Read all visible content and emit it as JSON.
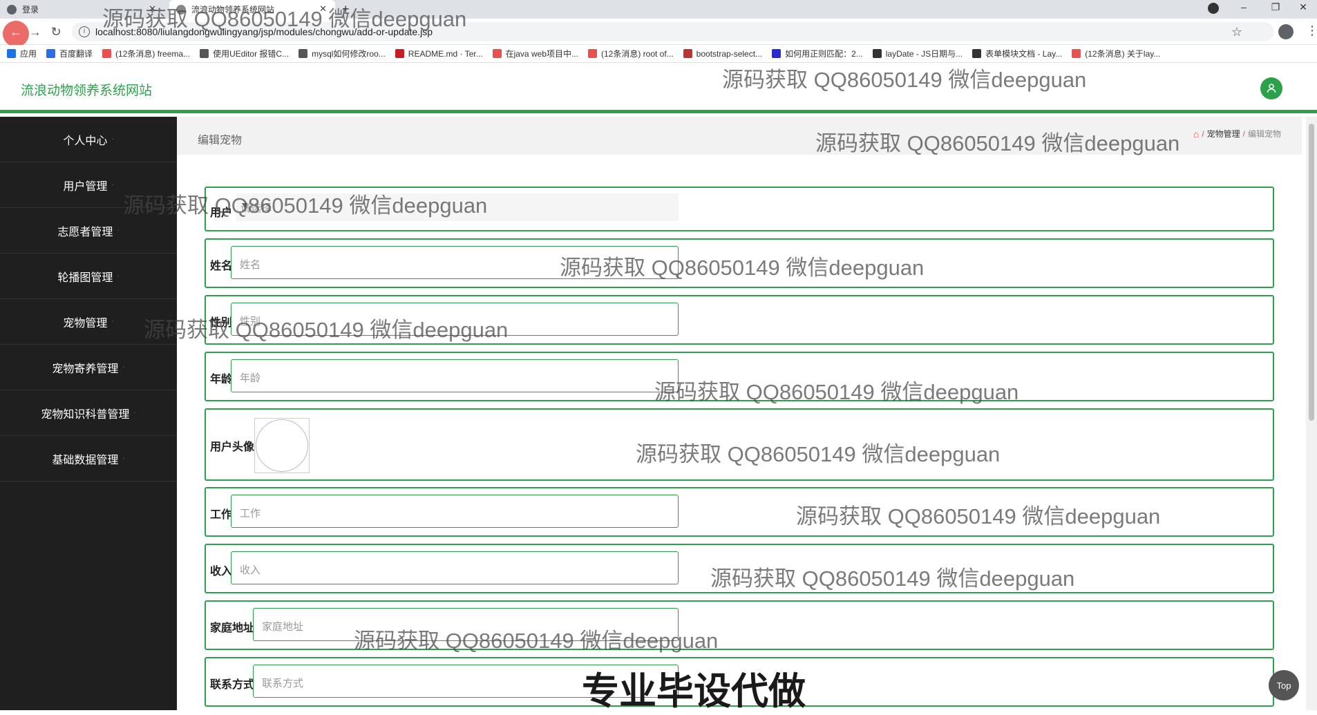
{
  "browser": {
    "tabs": [
      {
        "title": "登录"
      },
      {
        "title": "流浪动物领养系统网站"
      }
    ],
    "new_tab": "+",
    "url": "localhost:8080/liulangdongwulingyang/jsp/modules/chongwu/add-or-update.jsp",
    "bookmarks": [
      {
        "label": "应用",
        "color": "#1a73e8"
      },
      {
        "label": "百度翻译",
        "color": "#2b6de5"
      },
      {
        "label": "(12条消息) freema...",
        "color": "#e8514d"
      },
      {
        "label": "使用UEditor 报错C...",
        "color": "#555555"
      },
      {
        "label": "mysql如何修改roo...",
        "color": "#555555"
      },
      {
        "label": "README.md · Ter...",
        "color": "#c71d23"
      },
      {
        "label": "在java web项目中...",
        "color": "#e8514d"
      },
      {
        "label": "(12条消息) root of...",
        "color": "#e8514d"
      },
      {
        "label": "bootstrap-select...",
        "color": "#b33"
      },
      {
        "label": "如何用正则匹配：2...",
        "color": "#2b2bd6"
      },
      {
        "label": "layDate - JS日期与...",
        "color": "#333333"
      },
      {
        "label": "表单模块文档 - Lay...",
        "color": "#333333"
      },
      {
        "label": "(12条消息) 关于lay...",
        "color": "#e8514d"
      }
    ]
  },
  "header": {
    "site_title": "流浪动物领养系统网站"
  },
  "sidebar": {
    "items": [
      {
        "label": "个人中心"
      },
      {
        "label": "用户管理"
      },
      {
        "label": "志愿者管理"
      },
      {
        "label": "轮播图管理"
      },
      {
        "label": "宠物管理"
      },
      {
        "label": "宠物寄养管理"
      },
      {
        "label": "宠物知识科普管理"
      },
      {
        "label": "基础数据管理"
      }
    ]
  },
  "page": {
    "title": "编辑宠物",
    "breadcrumb": [
      "宠物管理",
      "编辑宠物"
    ]
  },
  "form": {
    "user": {
      "label": "用户",
      "placeholder": "请选择"
    },
    "name": {
      "label": "姓名",
      "placeholder": "姓名"
    },
    "gender": {
      "label": "性别",
      "placeholder": "性别"
    },
    "age": {
      "label": "年龄",
      "placeholder": "年龄"
    },
    "avatar": {
      "label": "用户头像"
    },
    "job": {
      "label": "工作",
      "placeholder": "工作"
    },
    "income": {
      "label": "收入",
      "placeholder": "收入"
    },
    "address": {
      "label": "家庭地址",
      "placeholder": "家庭地址"
    },
    "contact": {
      "label": "联系方式",
      "placeholder": "联系方式"
    }
  },
  "top_button": "Top",
  "watermark": "源码获取 QQ86050149 微信deepguan",
  "banner": "专业毕设代做",
  "colors": {
    "accent": "#2aa14a",
    "sidebar_bg": "#1f1f1f",
    "breadcrumb_sep": "#e8514d"
  }
}
